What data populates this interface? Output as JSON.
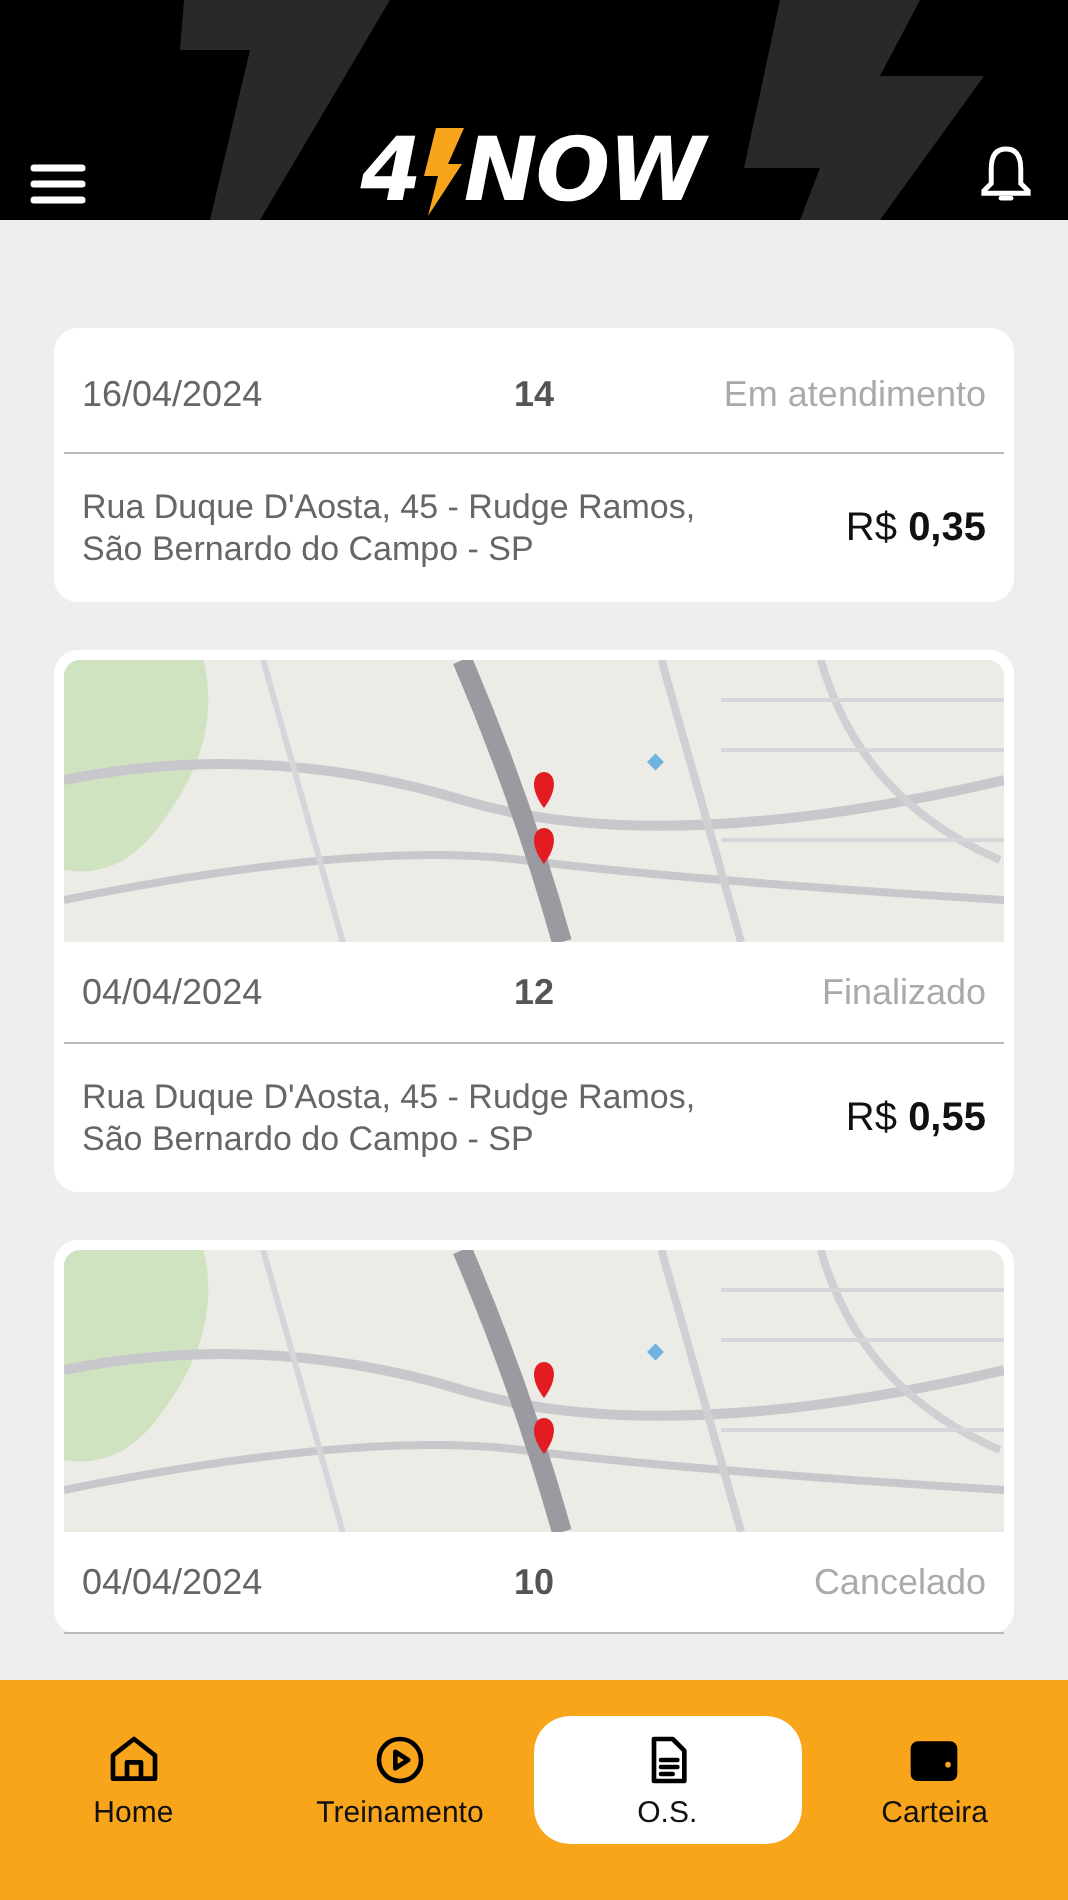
{
  "header": {
    "logo": {
      "lead": "4",
      "rest": "NOW"
    }
  },
  "orders": [
    {
      "kind": "plain",
      "date": "16/04/2024",
      "number": "14",
      "status": "Em atendimento",
      "address": "Rua Duque D'Aosta, 45 - Rudge Ramos, São Bernardo do Campo - SP",
      "currency": "R$",
      "amount": "0,35"
    },
    {
      "kind": "map",
      "date": "04/04/2024",
      "number": "12",
      "status": "Finalizado",
      "address": "Rua Duque D'Aosta, 45 - Rudge Ramos, São Bernardo do Campo - SP",
      "currency": "R$",
      "amount": "0,55"
    },
    {
      "kind": "map",
      "date": "04/04/2024",
      "number": "10",
      "status": "Cancelado"
    }
  ],
  "nav": [
    {
      "kind": "home",
      "label": "Home",
      "selected": false
    },
    {
      "kind": "play",
      "label": "Treinamento",
      "selected": false
    },
    {
      "kind": "document",
      "label": "O.S.",
      "selected": true
    },
    {
      "kind": "wallet",
      "label": "Carteira",
      "selected": false
    }
  ]
}
